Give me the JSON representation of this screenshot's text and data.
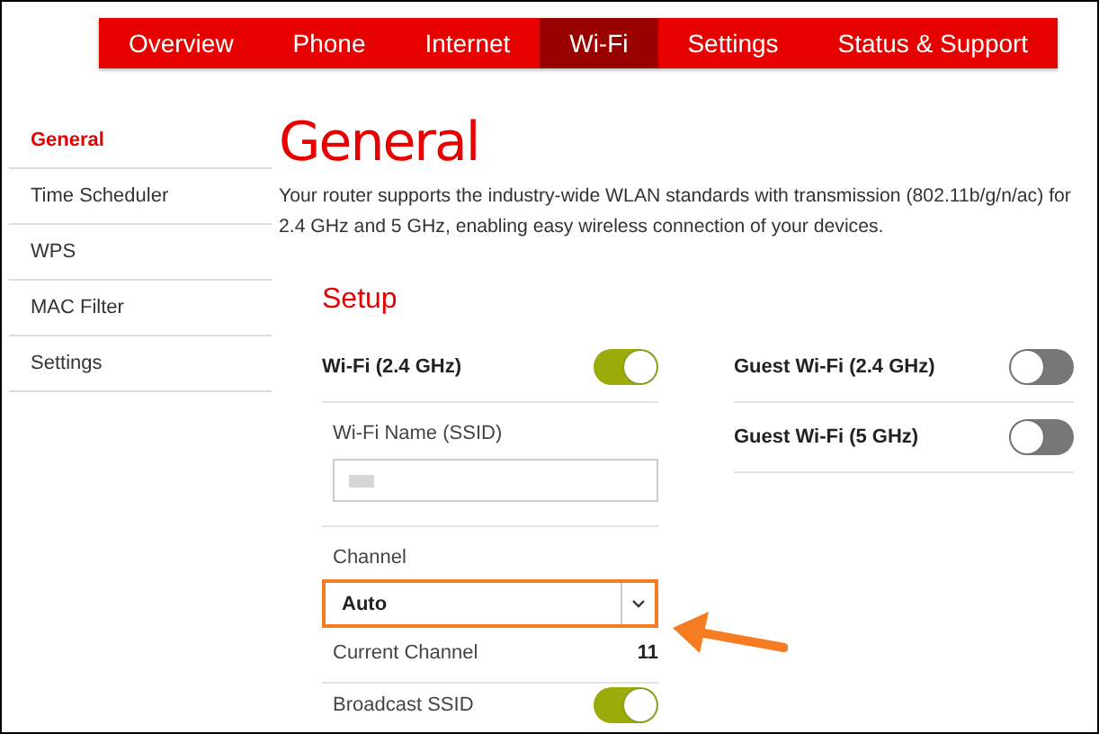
{
  "nav": {
    "tabs": [
      {
        "label": "Overview",
        "selected": false
      },
      {
        "label": "Phone",
        "selected": false
      },
      {
        "label": "Internet",
        "selected": false
      },
      {
        "label": "Wi-Fi",
        "selected": true
      },
      {
        "label": "Settings",
        "selected": false
      },
      {
        "label": "Status & Support",
        "selected": false
      }
    ]
  },
  "sidebar": {
    "items": [
      {
        "label": "General",
        "selected": true
      },
      {
        "label": "Time Scheduler",
        "selected": false
      },
      {
        "label": "WPS",
        "selected": false
      },
      {
        "label": "MAC Filter",
        "selected": false
      },
      {
        "label": "Settings",
        "selected": false
      }
    ]
  },
  "page": {
    "title": "General",
    "description": "Your router supports the industry-wide WLAN standards with transmission (802.11b/g/n/ac) for 2.4 GHz and 5 GHz, enabling easy wireless connection of your devices."
  },
  "setup": {
    "heading": "Setup",
    "wifi": {
      "label": "Wi-Fi (2.4 GHz)",
      "on": true
    },
    "ssid": {
      "label": "Wi-Fi Name (SSID)"
    },
    "channel": {
      "label": "Channel",
      "value": "Auto",
      "highlighted": true
    },
    "current_channel": {
      "label": "Current Channel",
      "value": "11"
    },
    "broadcast_ssid": {
      "label": "Broadcast SSID",
      "on": true
    },
    "guest": [
      {
        "label": "Guest Wi-Fi (2.4 GHz)",
        "on": false
      },
      {
        "label": "Guest Wi-Fi (5 GHz)",
        "on": false
      }
    ]
  }
}
